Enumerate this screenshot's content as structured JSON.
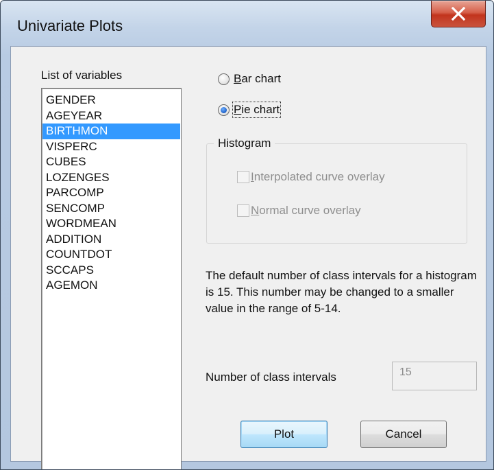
{
  "window": {
    "title": "Univariate Plots",
    "close_glyph": "X"
  },
  "list": {
    "label": "List of variables",
    "selected": "BIRTHMON",
    "items": [
      "GENDER",
      "AGEYEAR",
      "BIRTHMON",
      "VISPERC",
      "CUBES",
      "LOZENGES",
      "PARCOMP",
      "SENCOMP",
      "WORDMEAN",
      "ADDITION",
      "COUNTDOT",
      "SCCAPS",
      "AGEMON"
    ]
  },
  "chart_type": {
    "bar": {
      "mnemonic": "B",
      "rest": "ar chart",
      "checked": false
    },
    "pie": {
      "mnemonic": "P",
      "rest": "ie chart",
      "checked": true
    }
  },
  "histogram": {
    "title": "Histogram",
    "interpolated": {
      "mnemonic": "I",
      "rest": "nterpolated curve overlay",
      "checked": false,
      "enabled": false
    },
    "normal": {
      "mnemonic": "N",
      "rest": "ormal curve overlay",
      "checked": false,
      "enabled": false
    }
  },
  "description": "The default number of class intervals for a histogram is 15. This number may be changed to a  smaller value in the range of 5-14.",
  "intervals": {
    "label": "Number of class intervals",
    "value": "15"
  },
  "buttons": {
    "plot": "Plot",
    "cancel": "Cancel"
  },
  "colors": {
    "selection": "#3399ff",
    "close_button": "#c9533d"
  }
}
